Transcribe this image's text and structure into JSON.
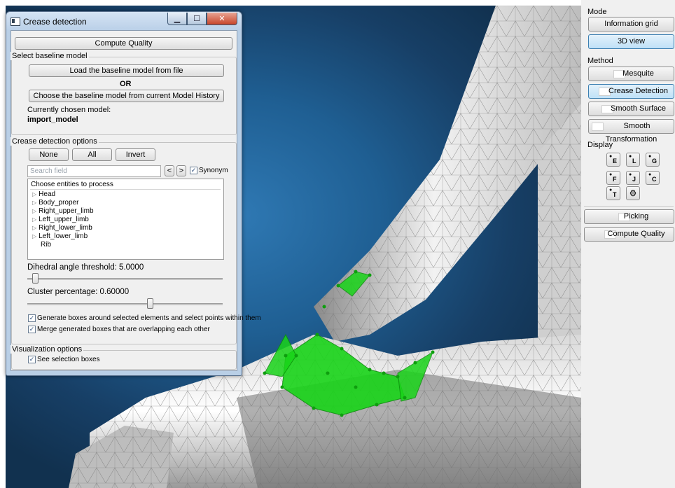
{
  "dialog": {
    "title": "Crease detection",
    "compute_quality": "Compute Quality",
    "baseline_group": "Select baseline model",
    "load_file": "Load the baseline model from file",
    "or": "OR",
    "choose_history": "Choose the baseline model from current Model History",
    "chosen_label": "Currently chosen model:",
    "chosen_value": "import_model",
    "options_group": "Crease detection options",
    "none": "None",
    "all": "All",
    "invert": "Invert",
    "search_placeholder": "Search field",
    "prev": "<",
    "next": ">",
    "synonym": "Synonym",
    "entities_header": "Choose entities to process",
    "entities": [
      "Head",
      "Body_proper",
      "Right_upper_limb",
      "Left_upper_limb",
      "Right_lower_limb",
      "Left_lower_limb",
      "Rib"
    ],
    "dihedral_label": "Dihedral angle threshold:  5.0000",
    "dihedral_value": 5.0,
    "cluster_label": "Cluster percentage:  0.60000",
    "cluster_value": 0.6,
    "generate_boxes": "Generate boxes around selected elements and select points within them",
    "merge_boxes": "Merge generated boxes that are overlapping each other",
    "vis_group": "Visualization options",
    "see_boxes": "See selection boxes"
  },
  "panel": {
    "mode_label": "Mode",
    "info_grid": "Information grid",
    "view3d": "3D view",
    "method_label": "Method",
    "mesquite": "Mesquite",
    "crease": "Crease Detection",
    "smooth_surface": "Smooth Surface",
    "smooth_transform": "Smooth Transformation",
    "display_label": "Display",
    "display_buttons": [
      "E",
      "L",
      "G",
      "F",
      "J",
      "C",
      "T"
    ],
    "picking": "Picking",
    "compute_quality": "Compute Quality"
  },
  "colors": {
    "accent": "#3c7fb1",
    "selection": "#19d419",
    "background": "#1f5f93"
  }
}
